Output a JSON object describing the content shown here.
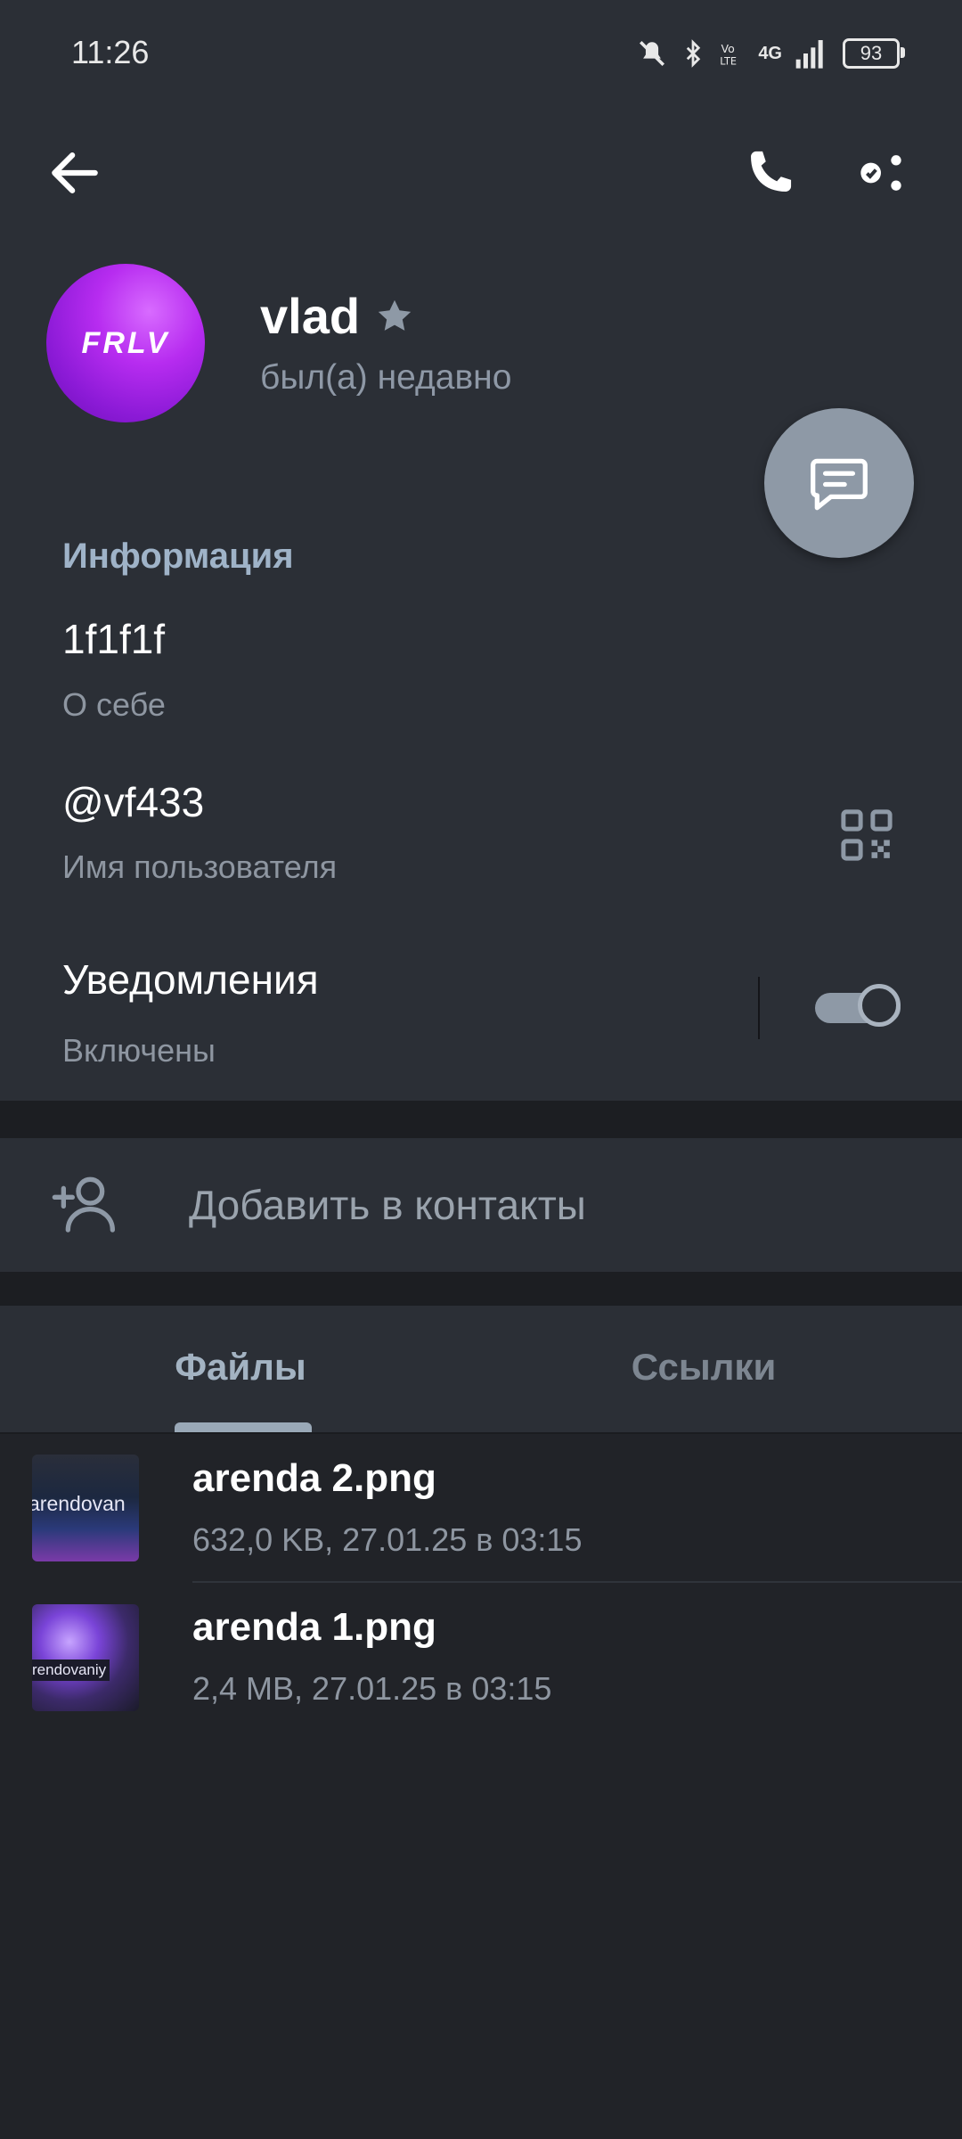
{
  "status_bar": {
    "time": "11:26",
    "battery": "93",
    "network": "4G"
  },
  "profile": {
    "avatar_text": "FRLV",
    "name": "vlad",
    "last_seen": "был(а) недавно"
  },
  "info": {
    "section_title": "Информация",
    "bio_value": "1f1f1f",
    "bio_label": "О себе",
    "username_value": "@vf433",
    "username_label": "Имя пользователя",
    "notifications_title": "Уведомления",
    "notifications_state": "Включены",
    "notifications_on": true
  },
  "add_contact_label": "Добавить в контакты",
  "tabs": [
    {
      "label": "Файлы",
      "active": true
    },
    {
      "label": "Ссылки",
      "active": false
    }
  ],
  "files": [
    {
      "name": "arenda 2.png",
      "meta": "632,0 KB, 27.01.25 в 03:15",
      "thumb_text": "arendovan"
    },
    {
      "name": "arenda 1.png",
      "meta": "2,4 MB, 27.01.25 в 03:15",
      "thumb_text": "rendovaniy"
    }
  ],
  "colors": {
    "accent": "#8e99a6",
    "background": "#2b2f36",
    "page": "#212328"
  },
  "icons": [
    "back-arrow-icon",
    "phone-icon",
    "more-icon",
    "message-icon",
    "qr-code-icon",
    "add-user-icon",
    "star-icon"
  ]
}
